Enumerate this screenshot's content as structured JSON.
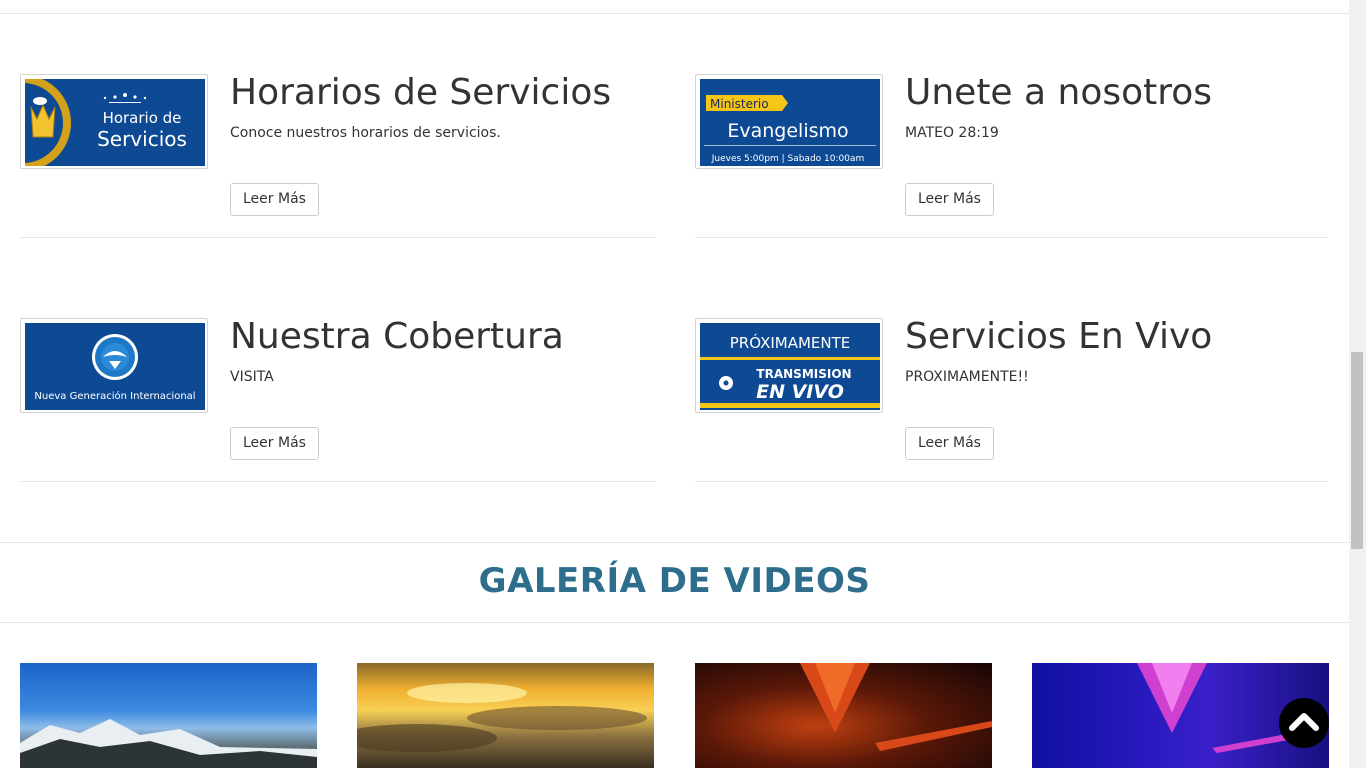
{
  "cards": [
    {
      "title": "Horarios de Servicios",
      "description": "Conoce nuestros horarios de servicios.",
      "button": "Leer Más",
      "image_text": {
        "line1": "Horario de",
        "line2": "Servicios"
      }
    },
    {
      "title": "Unete a nosotros",
      "description": "MATEO 28:19",
      "button": "Leer Más",
      "image_text": {
        "tag": "Ministerio",
        "main": "Evangelismo",
        "schedule": "Jueves 5:00pm  |  Sabado 10:00am"
      }
    },
    {
      "title": "Nuestra Cobertura",
      "description": "VISITA",
      "button": "Leer Más",
      "image_text": {
        "caption": "Nueva Generación Internacional"
      }
    },
    {
      "title": "Servicios En Vivo",
      "description": "PROXIMAMENTE!!",
      "button": "Leer Más",
      "image_text": {
        "line1": "PRÓXIMAMENTE",
        "line2": "TRANSMISION",
        "line3": "EN VIVO"
      }
    }
  ],
  "gallery": {
    "title": "GALERÍA DE VIDEOS"
  },
  "colors": {
    "heading_accent": "#2e6e8c",
    "thumb_blue": "#0e4a94",
    "ribbon_yellow": "#f5c518"
  },
  "icons": {
    "back_to_top": "chevron-up-icon"
  }
}
